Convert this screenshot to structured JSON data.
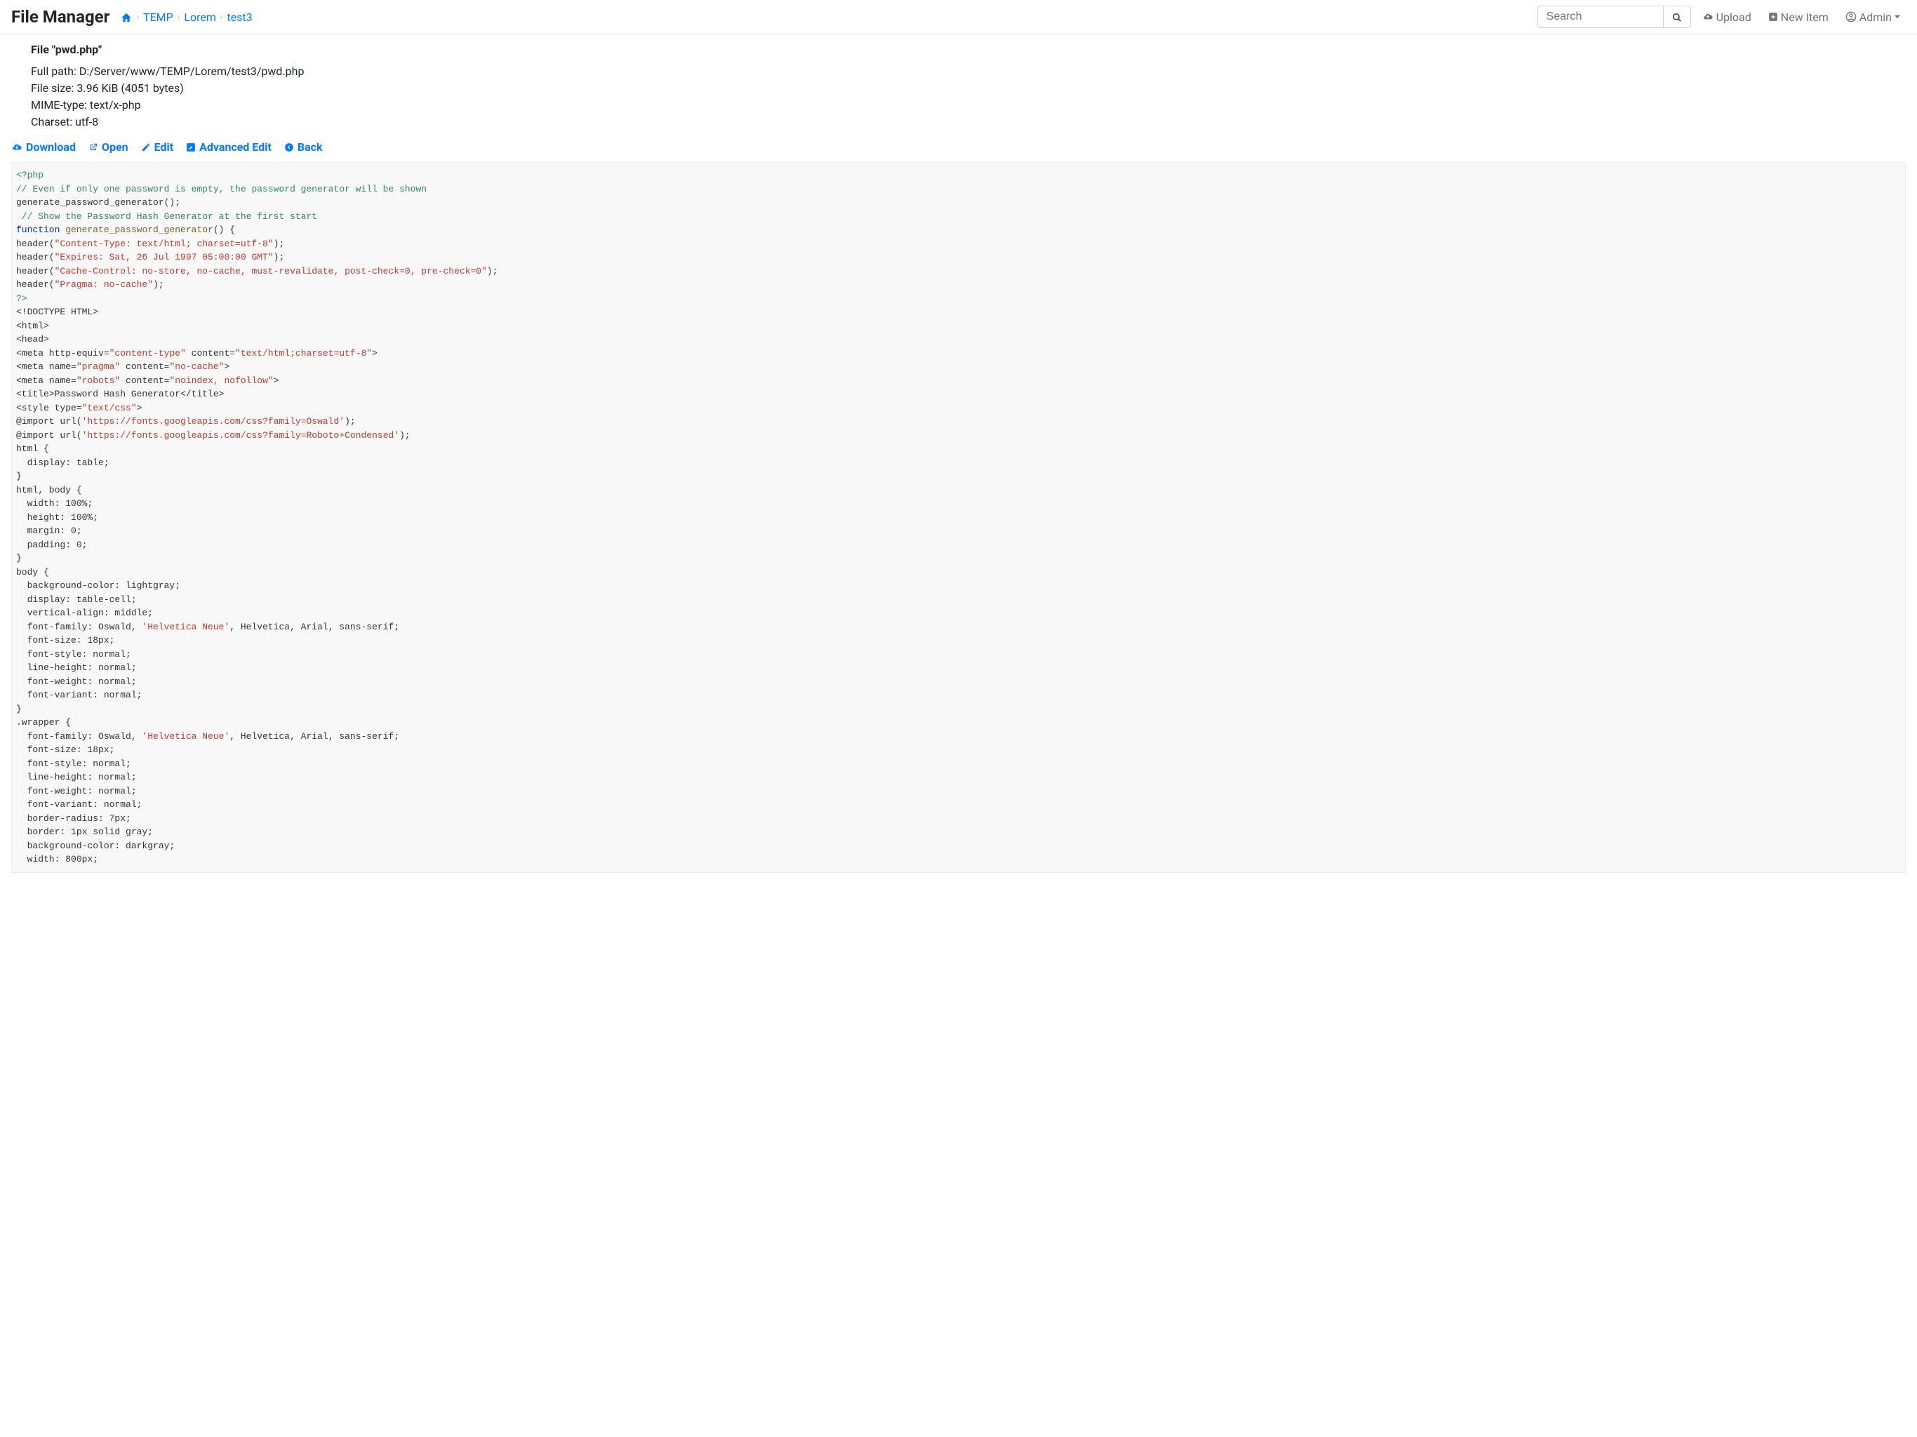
{
  "brand": "File Manager",
  "breadcrumb": [
    "TEMP",
    "Lorem",
    "test3"
  ],
  "search": {
    "placeholder": "Search"
  },
  "nav": {
    "upload": "Upload",
    "newitem": "New Item",
    "admin": "Admin"
  },
  "file": {
    "title": "File \"pwd.php\"",
    "fullpath_label": "Full path: ",
    "fullpath": "D:/Server/www/TEMP/Lorem/test3/pwd.php",
    "size_label": "File size: ",
    "size": "3.96 KiB (4051 bytes)",
    "mime_label": "MIME-type: ",
    "mime": "text/x-php",
    "charset_label": "Charset: ",
    "charset": "utf-8"
  },
  "actions": {
    "download": "Download",
    "open": "Open",
    "edit": "Edit",
    "advanced": "Advanced Edit",
    "back": "Back"
  },
  "code": {
    "line1": "<?php",
    "line2": "// Even if only one password is empty, the password generator will be shown",
    "line3": "generate_password_generator();",
    "line4": " // Show the Password Hash Generator at the first start",
    "line5_kw": "function",
    "line5_fn": " generate_password_generator",
    "line5_rest": "() {",
    "hdr_pre": "header(",
    "hdr_post": ");",
    "str1": "\"Content-Type: text/html; charset=utf-8\"",
    "str2": "\"Expires: Sat, 26 Jul 1997 05:00:00 GMT\"",
    "str3": "\"Cache-Control: no-store, no-cache, must-revalidate, post-check=0, pre-check=0\"",
    "str4": "\"Pragma: no-cache\"",
    "close_php": "?>",
    "doctype": "<!DOCTYPE HTML>",
    "html_open": "<html>",
    "head_open": "<head>",
    "meta1_pre": "<meta http-equiv=",
    "meta1_s1": "\"content-type\"",
    "meta1_mid": " content=",
    "meta1_s2": "\"text/html;charset=utf-8\"",
    "meta1_post": ">",
    "meta2_pre": "<meta name=",
    "meta2_s1": "\"pragma\"",
    "meta2_mid": " content=",
    "meta2_s2": "\"no-cache\"",
    "meta2_post": ">",
    "meta3_pre": "<meta name=",
    "meta3_s1": "\"robots\"",
    "meta3_mid": " content=",
    "meta3_s2": "\"noindex, nofollow\"",
    "meta3_post": ">",
    "title_line": "<title>Password Hash Generator</title>",
    "style_pre": "<style type=",
    "style_s": "\"text/css\"",
    "style_post": ">",
    "import1_pre": "@import url(",
    "import1_s": "'https://fonts.googleapis.com/css?family=Oswald'",
    "import1_post": ");",
    "import2_pre": "@import url(",
    "import2_s": "'https://fonts.googleapis.com/css?family=Roboto+Condensed'",
    "import2_post": ");",
    "css_html": "html {",
    "css_disp_table": "  display: table;",
    "brace_close": "}",
    "css_htmlbody": "html, body {",
    "css_w100": "  width: 100%;",
    "css_h100": "  height: 100%;",
    "css_m0": "  margin: 0;",
    "css_p0": "  padding: 0;",
    "css_body": "body {",
    "css_bg_lg": "  background-color: lightgray;",
    "css_disp_tc": "  display: table-cell;",
    "css_va_m": "  vertical-align: middle;",
    "css_ff_pre": "  font-family: Oswald, ",
    "css_ff_s": "'Helvetica Neue'",
    "css_ff_post": ", Helvetica, Arial, sans-serif;",
    "css_fs18": "  font-size: 18px;",
    "css_fsn": "  font-style: normal;",
    "css_lhn": "  line-height: normal;",
    "css_fwn": "  font-weight: normal;",
    "css_fvn": "  font-variant: normal;",
    "css_wrapper": ".wrapper {",
    "css_br7": "  border-radius: 7px;",
    "css_b1g": "  border: 1px solid gray;",
    "css_bg_dg": "  background-color: darkgray;",
    "css_w800": "  width: 800px;"
  }
}
